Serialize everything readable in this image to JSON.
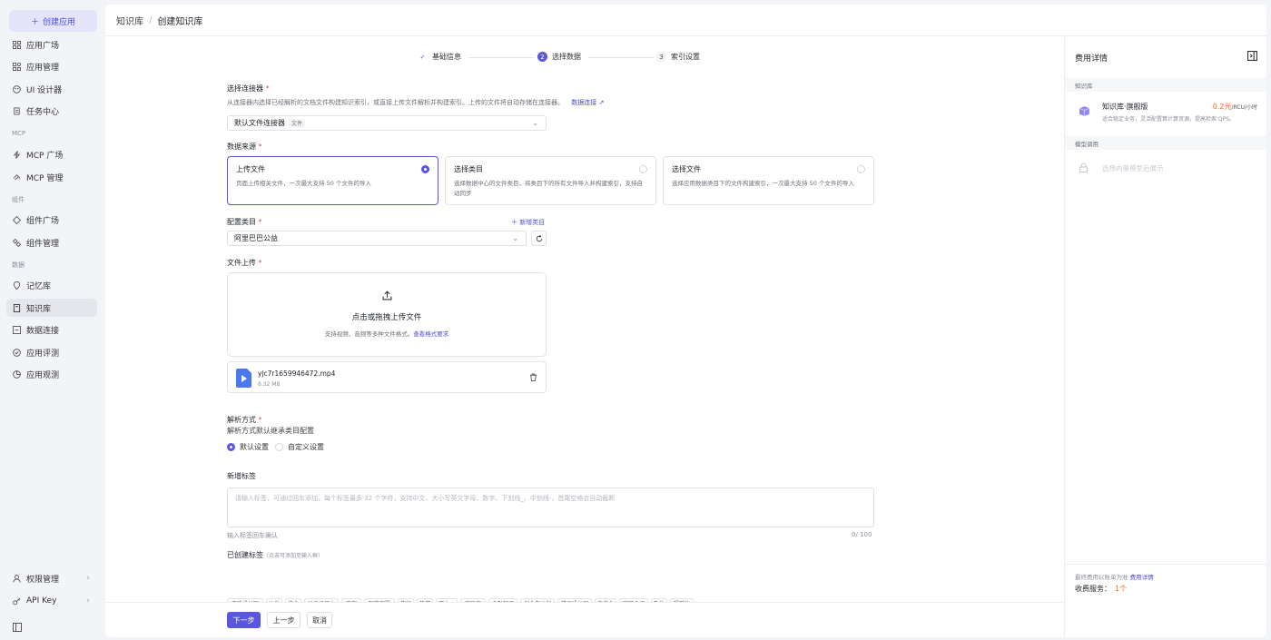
{
  "sidebar": {
    "create_label": "创建应用",
    "groups": {
      "mcp": "MCP",
      "component": "组件",
      "data": "数据"
    },
    "items": [
      {
        "label": "应用广场",
        "icon": "grid-icon"
      },
      {
        "label": "应用管理",
        "icon": "apps-icon"
      },
      {
        "label": "UI 设计器",
        "icon": "palette-icon"
      },
      {
        "label": "任务中心",
        "icon": "task-icon"
      },
      {
        "label": "MCP 广场",
        "icon": "lightning-icon"
      },
      {
        "label": "MCP 管理",
        "icon": "mcp-icon"
      },
      {
        "label": "组件广场",
        "icon": "component-icon"
      },
      {
        "label": "组件管理",
        "icon": "component-manage-icon"
      },
      {
        "label": "记忆库",
        "icon": "memory-icon"
      },
      {
        "label": "知识库",
        "icon": "book-icon"
      },
      {
        "label": "数据连接",
        "icon": "link-icon"
      },
      {
        "label": "应用评测",
        "icon": "evaluate-icon"
      },
      {
        "label": "应用观测",
        "icon": "observe-icon"
      }
    ],
    "bottom": [
      {
        "label": "权限管理",
        "icon": "user-icon"
      },
      {
        "label": "API Key",
        "icon": "key-icon"
      }
    ]
  },
  "header": {
    "crumb1": "知识库",
    "sep": "/",
    "crumb2": "创建知识库"
  },
  "steps": [
    {
      "num": "✓",
      "label": "基础信息",
      "state": "done"
    },
    {
      "num": "2",
      "label": "选择数据",
      "state": "active"
    },
    {
      "num": "3",
      "label": "索引设置",
      "state": "pending"
    }
  ],
  "connector": {
    "label": "选择连接器",
    "hint": "从连接器内选择已经解析的文档文件构建知识索引，或直接上传文件解析并构建索引。上传的文件将自动存储在连接器。",
    "link": "数据连接",
    "value": "默认文件连接器",
    "tag": "文件"
  },
  "source": {
    "label": "数据来源",
    "cards": [
      {
        "title": "上传文件",
        "desc": "页面上传相关文件，一次最大支持 50 个文件的导入"
      },
      {
        "title": "选择类目",
        "desc": "选择数据中心的文件类目，将类目下的所有文件导入并构建索引，支持自动同步"
      },
      {
        "title": "选择文件",
        "desc": "选择应用数据类目下的文件构建索引，一次最大支持 50 个文件的导入"
      }
    ]
  },
  "category": {
    "label": "配置类目",
    "add": "新增类目",
    "value": "阿里巴巴公益"
  },
  "upload": {
    "label": "文件上传",
    "title": "点击或拖拽上传文件",
    "hint": "支持视频、音频等多种文件格式。",
    "link": "查看格式要求",
    "file": {
      "name": "yjc7r1659946472.mp4",
      "size": "6.32 MB"
    }
  },
  "parse": {
    "label": "解析方式",
    "hint": "解析方式默认继承类目配置",
    "options": [
      "默认设置",
      "自定义设置"
    ]
  },
  "tags": {
    "label": "新增标签",
    "placeholder": "请输入标签，可通过回车添加，每个标签最多 32 个字符，支持中文、大小写英文字母、数字、下划线_、中划线-，首尾空格会自动截断",
    "helper": "输入标签回车确认",
    "count": "0/ 100",
    "created_label": "已创建标签",
    "created_hint": "（点击可添加至输入框）",
    "chips": [
      "正确设计图",
      "沙发",
      "作业",
      "对话机器人",
      "度假",
      "智能客服",
      "旅行",
      "旅游",
      "双十一",
      "庞联商",
      "金融知识",
      "创业者计划",
      "错误设计图",
      "真作业",
      "官网介绍",
      "政治",
      "规范化"
    ]
  },
  "footer": {
    "next": "下一步",
    "prev": "上一步",
    "cancel": "取消"
  },
  "cost": {
    "title": "费用详情",
    "kb_section": "知识库",
    "kb_name": "知识库·旗舰版",
    "kb_price": "0.2元",
    "kb_unit": "/RCU/小时",
    "kb_desc": "适合稳定业务，灵活配置算计算资源，提高检索 QPS。",
    "model_section": "模型调用",
    "model_placeholder": "选择向量模型后展示",
    "bottom_note": "最终费用以账单为准",
    "bottom_link": "费用详情",
    "service_label": "收费服务：",
    "service_count": "1个"
  },
  "colors": {
    "accent": "#5b56e0",
    "price": "#f26b1d",
    "required": "#e14d4d"
  }
}
